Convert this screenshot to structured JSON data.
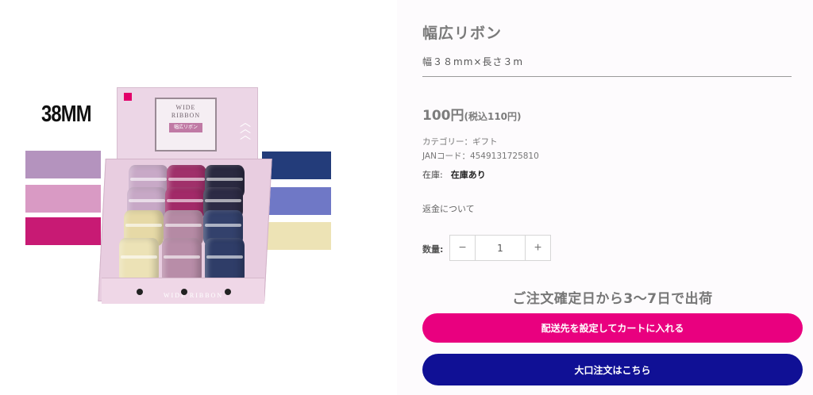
{
  "product": {
    "title": "幅広リボン",
    "spec": "幅３８mm×長さ３m",
    "price": "100円",
    "price_tax": "(税込110円)",
    "category": "カテゴリー：ギフト",
    "jan": "JANコード：4549131725810",
    "stock_label": "在庫:",
    "stock_value": "在庫あり",
    "refund_link": "返金について",
    "qty_label": "数量:",
    "qty_value": "1",
    "qty_minus": "−",
    "qty_plus": "+",
    "ship_note": "ご注文確定日から3〜7日で出荷",
    "cart_button": "配送先を設定してカートに入れる",
    "bulk_button": "大口注文はこちら"
  },
  "image": {
    "size_label": "38MM",
    "package_title": "WIDE RIBBON",
    "package_title_line1": "WIDE",
    "package_title_line2": "RIBBON",
    "package_tag": "幅広リボン",
    "tray_text": "WIDE RIBBON",
    "swatches_left": [
      "#b493be",
      "#d99ac4",
      "#c81a74"
    ],
    "swatches_right": [
      "#233c7a",
      "#6f78c6",
      "#ede3b5"
    ]
  },
  "colors": {
    "cart_button": "#e9007f",
    "bulk_button": "#101095"
  }
}
